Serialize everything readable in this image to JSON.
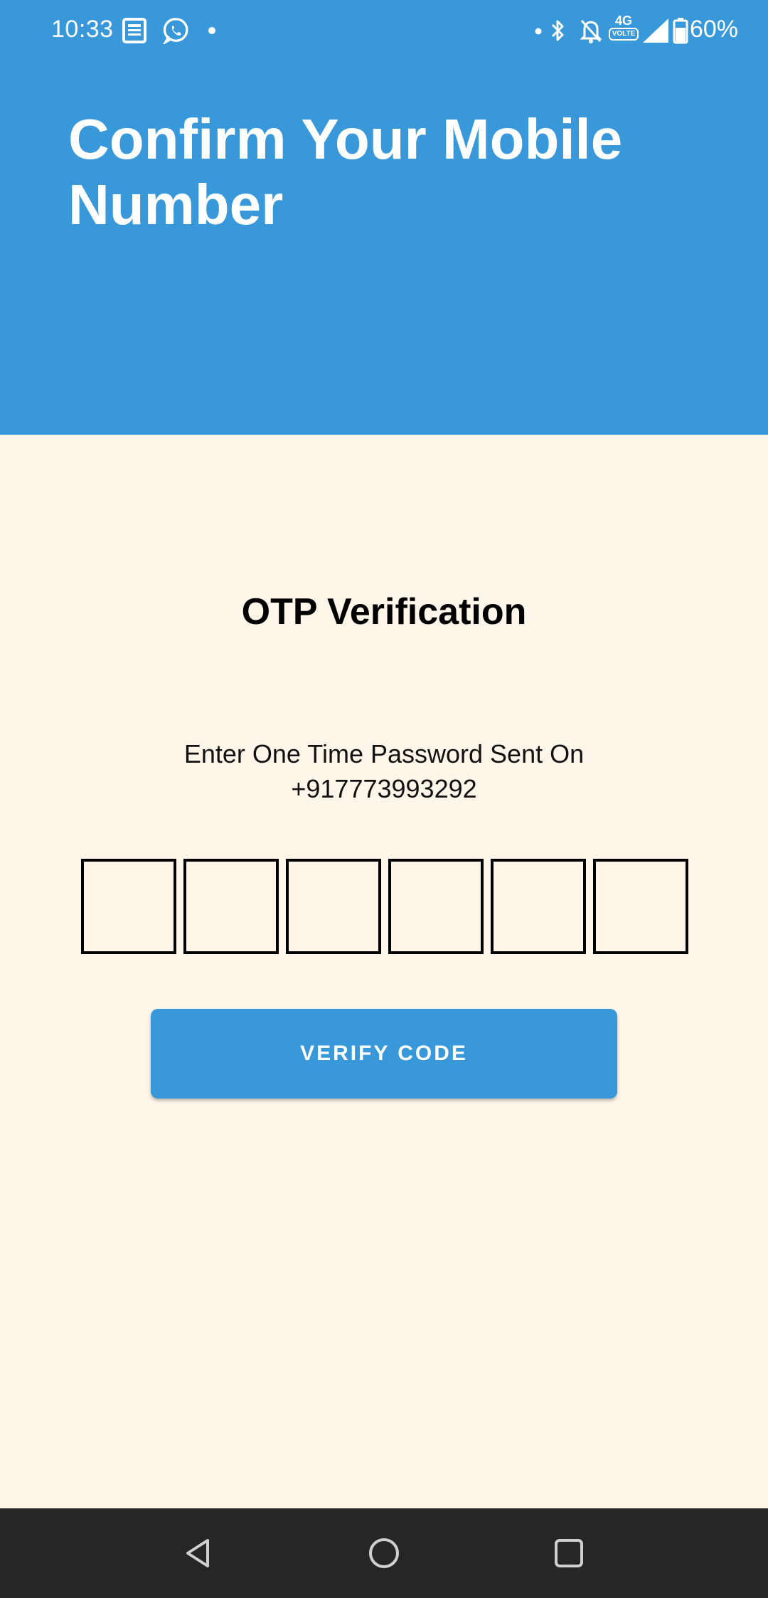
{
  "status_bar": {
    "time": "10:33",
    "battery": "60%",
    "network_label": "4G",
    "volte_label": "VOLTE",
    "icons": [
      "news-icon",
      "whatsapp-icon",
      "dot-icon",
      "dot-icon",
      "bluetooth-icon",
      "bell-off-icon",
      "4g-volte-icon",
      "signal-icon",
      "battery-icon"
    ]
  },
  "header": {
    "title": "Confirm Your Mobile Number",
    "background_color": "#3898d9"
  },
  "otp": {
    "heading": "OTP Verification",
    "instruction_line1": "Enter One Time Password Sent On",
    "phone_number": "+917773993292",
    "digits": [
      "",
      "",
      "",
      "",
      "",
      ""
    ]
  },
  "actions": {
    "verify_label": "VERIFY CODE",
    "button_color": "#3898d9"
  },
  "nav_bar": {
    "buttons": [
      "back-icon",
      "home-icon",
      "recents-icon"
    ]
  },
  "colors": {
    "page_background": "#fff5e8",
    "nav_background": "#262626"
  }
}
